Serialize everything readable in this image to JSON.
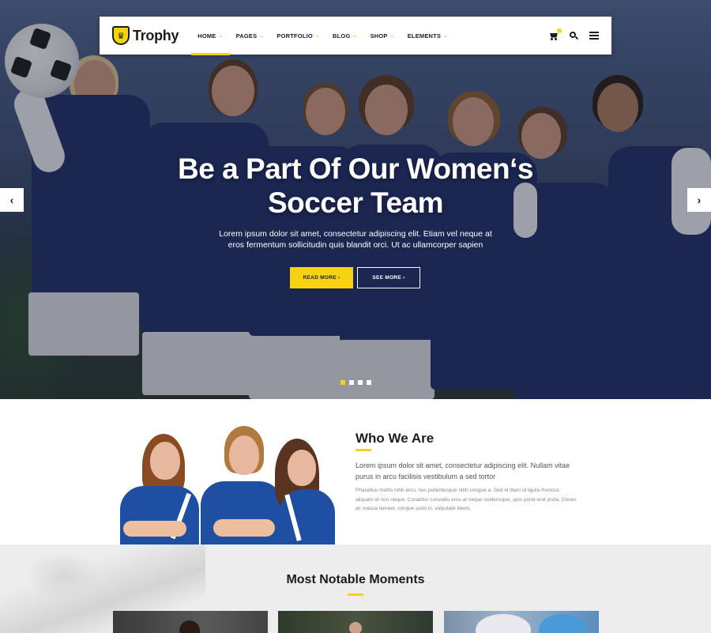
{
  "brand": {
    "name": "Trophy",
    "accent": "#f5d313"
  },
  "nav": {
    "items": [
      {
        "label": "HOME",
        "active": true
      },
      {
        "label": "PAGES",
        "active": false
      },
      {
        "label": "PORTFOLIO",
        "active": false
      },
      {
        "label": "BLOG",
        "active": false
      },
      {
        "label": "SHOP",
        "active": false
      },
      {
        "label": "ELEMENTS",
        "active": false
      }
    ],
    "icons": [
      "cart-icon",
      "search-icon",
      "menu-icon"
    ]
  },
  "hero": {
    "title_line1": "Be a Part Of Our Women‘s",
    "title_line2": "Soccer Team",
    "subtitle": "Lorem ipsum dolor sit amet, consectetur adipiscing elit. Etiam vel neque at eros fermentum sollicitudin quis blandit orci. Ut ac ullamcorper sapien",
    "read_more": "READ MORE",
    "see_more": "SEE MORE",
    "slides": 4,
    "active_slide": 1
  },
  "who": {
    "title": "Who We Are",
    "lead": "Lorem ipsum dolor sit amet, consectetur adipiscing elit. Nullam vitae purus in arcu facilisis vestibulum a sed tortor",
    "body": "Phasellus mattis nibh arcu, nec pellentesque nibh congue a. Sed id diam id ligula rhoncus aliquam id non neque. Curabitur convallis eros at neque scelerisque, quis porta erat porta. Donec ac massa laoreet, congue justo in, vulputate libero."
  },
  "moments": {
    "title": "Most Notable Moments"
  }
}
